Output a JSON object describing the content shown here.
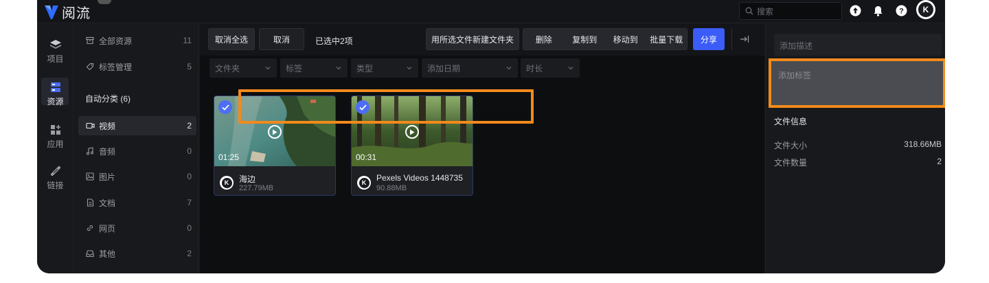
{
  "app": {
    "name": "阅流"
  },
  "search": {
    "placeholder": "搜索"
  },
  "user": {
    "initial": "K"
  },
  "rail": [
    {
      "label": "项目",
      "icon": "layers-icon"
    },
    {
      "label": "资源",
      "icon": "resources-icon"
    },
    {
      "label": "应用",
      "icon": "apps-icon"
    },
    {
      "label": "链接",
      "icon": "link-icon"
    }
  ],
  "sidebar": {
    "top": [
      {
        "label": "全部资源",
        "count": "11",
        "icon": "archive-icon"
      },
      {
        "label": "标签管理",
        "count": "5",
        "icon": "tag-icon"
      }
    ],
    "auto_header": "自动分类 (6)",
    "categories": [
      {
        "label": "视频",
        "count": "2",
        "icon": "video-icon"
      },
      {
        "label": "音频",
        "count": "0",
        "icon": "music-icon"
      },
      {
        "label": "图片",
        "count": "0",
        "icon": "image-icon"
      },
      {
        "label": "文档",
        "count": "7",
        "icon": "document-icon"
      },
      {
        "label": "网页",
        "count": "0",
        "icon": "link-icon"
      },
      {
        "label": "其他",
        "count": "2",
        "icon": "inbox-icon"
      }
    ]
  },
  "toolbar": {
    "deselect_all": "取消全选",
    "cancel": "取消",
    "selected_text": "已选中2项",
    "new_folder": "用所选文件新建文件夹",
    "delete": "删除",
    "copy_to": "复制到",
    "move_to": "移动到",
    "batch_download": "批量下载",
    "share": "分享"
  },
  "filters": [
    "文件夹",
    "标签",
    "类型",
    "添加日期",
    "时长"
  ],
  "cards": [
    {
      "name": "海边",
      "size": "227.79MB",
      "duration": "01:25"
    },
    {
      "name": "Pexels Videos 1448735",
      "size": "90.88MB",
      "duration": "00:31"
    }
  ],
  "right_panel": {
    "desc_placeholder": "添加描述",
    "tag_placeholder": "添加标签",
    "info_title": "文件信息",
    "rows": [
      {
        "label": "文件大小",
        "value": "318.66MB"
      },
      {
        "label": "文件数量",
        "value": "2"
      }
    ]
  },
  "colors": {
    "accent": "#3b5cf6",
    "highlight": "#f38a1c"
  }
}
